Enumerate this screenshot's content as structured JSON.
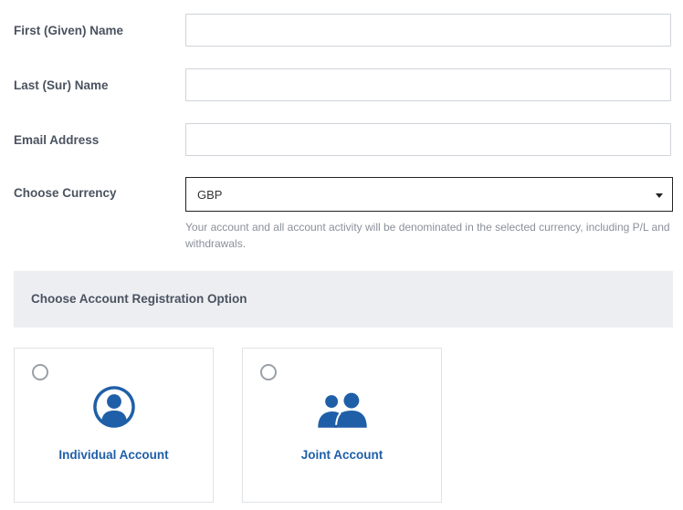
{
  "form": {
    "first_name": {
      "label": "First (Given) Name",
      "value": "",
      "placeholder": ""
    },
    "last_name": {
      "label": "Last (Sur) Name",
      "value": "",
      "placeholder": ""
    },
    "email": {
      "label": "Email Address",
      "value": "",
      "placeholder": ""
    },
    "currency": {
      "label": "Choose Currency",
      "selected": "GBP",
      "help": "Your account and all account activity will be denominated in the selected currency, including P/L and withdrawals."
    }
  },
  "registration": {
    "heading": "Choose Account Registration Option",
    "options": [
      {
        "label": "Individual Account",
        "icon": "single-user-icon",
        "selected": false
      },
      {
        "label": "Joint Account",
        "icon": "two-users-icon",
        "selected": false
      }
    ]
  },
  "colors": {
    "accent": "#1f5fa8",
    "label": "#4a5360",
    "band": "#edeef2"
  }
}
